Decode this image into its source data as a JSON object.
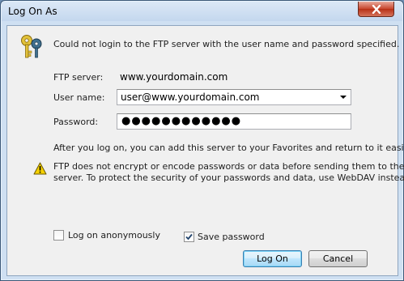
{
  "window": {
    "title": "Log On As",
    "close_icon": "close-icon"
  },
  "message": {
    "icon": "keys-icon",
    "text": "Could not login to the FTP server with the user name and password specified."
  },
  "form": {
    "server_label": "FTP server:",
    "server_value": "www.yourdomain.com",
    "username_label": "User name:",
    "username_value": "user@www.yourdomain.com",
    "password_label": "Password:",
    "password_mask": "●●●●●●●●●●●●"
  },
  "info_text": "After you log on, you can add this server to your Favorites and return to it easily.",
  "warning": {
    "icon": "warning-icon",
    "line1": "FTP does not encrypt or encode passwords or data before sending them to the",
    "line2": "server.  To protect the security of your passwords and data, use WebDAV instead."
  },
  "options": {
    "anonymous_label": "Log on anonymously",
    "anonymous_checked": false,
    "save_password_label": "Save password",
    "save_password_checked": true
  },
  "buttons": {
    "logon_label": "Log On",
    "cancel_label": "Cancel"
  },
  "colors": {
    "client_bg": "#f0f0f0",
    "title_bg": "#cfe0f2",
    "close_red": "#c7452d",
    "warning_yellow": "#f5d000"
  }
}
